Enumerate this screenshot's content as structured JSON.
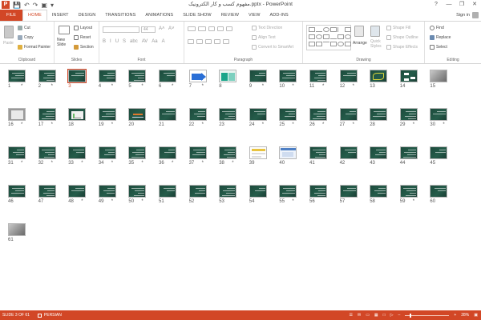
{
  "app": {
    "title": "مفهوم کسب و کار الکترونیک.pptx - PowerPoint",
    "window_controls": [
      "?",
      "—",
      "❐",
      "✕"
    ],
    "signin": "Sign in"
  },
  "tabs": [
    {
      "label": "FILE",
      "kind": "file"
    },
    {
      "label": "HOME",
      "kind": "active"
    },
    {
      "label": "INSERT",
      "kind": ""
    },
    {
      "label": "DESIGN",
      "kind": ""
    },
    {
      "label": "TRANSITIONS",
      "kind": ""
    },
    {
      "label": "ANIMATIONS",
      "kind": ""
    },
    {
      "label": "SLIDE SHOW",
      "kind": ""
    },
    {
      "label": "REVIEW",
      "kind": ""
    },
    {
      "label": "VIEW",
      "kind": ""
    },
    {
      "label": "ADD-INS",
      "kind": ""
    }
  ],
  "ribbon": {
    "clipboard": {
      "label": "Clipboard",
      "paste": "Paste",
      "cut": "Cut",
      "copy": "Copy",
      "format_painter": "Format Painter"
    },
    "slides": {
      "label": "Slides",
      "new_slide": "New Slide",
      "layout": "Layout",
      "reset": "Reset",
      "section": "Section"
    },
    "font": {
      "label": "Font",
      "size": "44",
      "buttons": [
        "B",
        "I",
        "U",
        "S",
        "abc",
        "AV",
        "Aa",
        "A"
      ]
    },
    "paragraph": {
      "label": "Paragraph",
      "text_direction": "Text Direction",
      "align_text": "Align Text",
      "smartart": "Convert to SmartArt"
    },
    "drawing": {
      "label": "Drawing",
      "arrange": "Arrange",
      "quick_styles": "Quick Styles",
      "shape_fill": "Shape Fill",
      "shape_outline": "Shape Outline",
      "shape_effects": "Shape Effects"
    },
    "editing": {
      "label": "Editing",
      "find": "Find",
      "replace": "Replace",
      "select": "Select"
    }
  },
  "slides": {
    "selected": 3,
    "star_mark": "*",
    "numbers": [
      "1",
      "2",
      "3",
      "4",
      "5",
      "6",
      "7",
      "8",
      "9",
      "10",
      "11",
      "12",
      "13",
      "14",
      "15",
      "16",
      "17",
      "18",
      "19",
      "20",
      "21",
      "22",
      "23",
      "24",
      "25",
      "26",
      "27",
      "28",
      "29",
      "30",
      "31",
      "32",
      "33",
      "34",
      "35",
      "36",
      "37",
      "38",
      "39",
      "40",
      "41",
      "42",
      "43",
      "44",
      "45",
      "46",
      "47",
      "48",
      "49",
      "50",
      "51",
      "52",
      "53",
      "54",
      "55",
      "56",
      "57",
      "58",
      "59",
      "60",
      "61"
    ],
    "starred": [
      1,
      2,
      4,
      5,
      6,
      7,
      9,
      10,
      11,
      12,
      16,
      17,
      19,
      22,
      24,
      25,
      26,
      27,
      29,
      30,
      31,
      32,
      33,
      34,
      35,
      36,
      37,
      38,
      48,
      49,
      50,
      55,
      59
    ],
    "special": {
      "7": "blue-arrows",
      "8": "teal-table",
      "13": "yellow-doodle",
      "14": "white-diagram",
      "15": "grey-photo",
      "16": "white-box",
      "18": "white-chart",
      "20": "orange-text",
      "39": "yellow-bars",
      "40": "blue-screenshot",
      "61": "grey-photo"
    }
  },
  "status": {
    "slide_info": "SLIDE 3 OF 61",
    "language": "PERSIAN",
    "zoom": "28%"
  },
  "colors": {
    "accent": "#d24726",
    "thumb_bg": "#1f4e40"
  }
}
